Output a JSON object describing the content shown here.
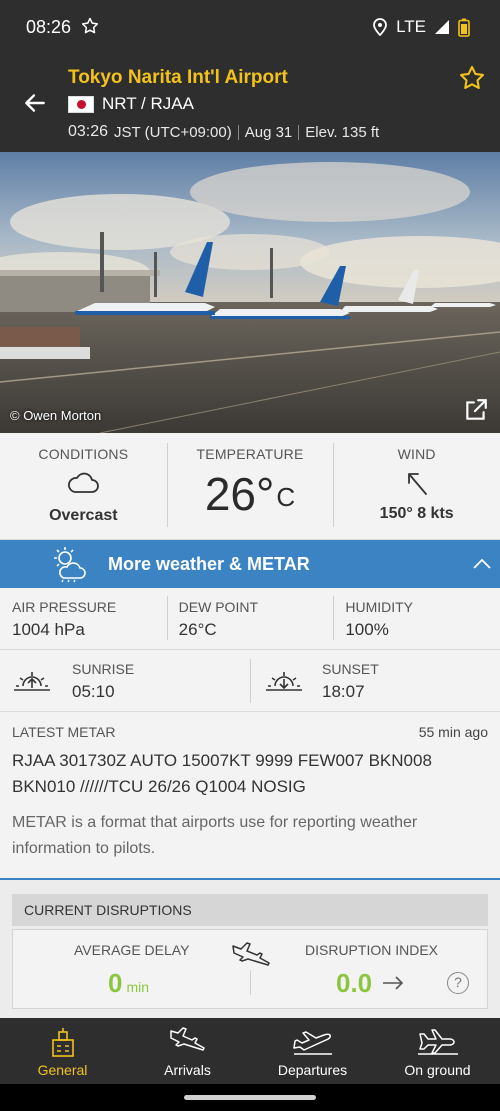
{
  "status_bar": {
    "time": "08:26",
    "network": "LTE"
  },
  "header": {
    "title": "Tokyo Narita Int'l Airport",
    "codes": "NRT / RJAA",
    "local_time": "03:26",
    "timezone": "JST (UTC+09:00)",
    "date": "Aug 31",
    "elevation": "Elev. 135 ft",
    "flag": "japan-flag"
  },
  "hero": {
    "credit": "© Owen Morton"
  },
  "conditions": {
    "conditions_label": "CONDITIONS",
    "conditions_value": "Overcast",
    "temperature_label": "TEMPERATURE",
    "temperature_value": "26°",
    "temperature_unit": "C",
    "wind_label": "WIND",
    "wind_value": "150° 8 kts"
  },
  "weather_bar": {
    "label": "More weather & METAR"
  },
  "stats": {
    "pressure_label": "AIR PRESSURE",
    "pressure_value": "1004 hPa",
    "dew_label": "DEW POINT",
    "dew_value": "26°C",
    "humidity_label": "HUMIDITY",
    "humidity_value": "100%"
  },
  "sun": {
    "sunrise_label": "SUNRISE",
    "sunrise_value": "05:10",
    "sunset_label": "SUNSET",
    "sunset_value": "18:07"
  },
  "metar": {
    "label": "LATEST METAR",
    "age": "55 min ago",
    "raw": "RJAA 301730Z AUTO 15007KT 9999 FEW007 BKN008 BKN010 //////TCU 26/26 Q1004 NOSIG",
    "note": "METAR is a format that airports use for reporting weather information to pilots."
  },
  "disruptions": {
    "header": "CURRENT DISRUPTIONS",
    "avg_delay_label": "AVERAGE DELAY",
    "avg_delay_value": "0",
    "avg_delay_unit": "min",
    "index_label": "DISRUPTION INDEX",
    "index_value": "0.0",
    "help_glyph": "?"
  },
  "tabs": [
    {
      "label": "General",
      "icon": "airport-building-icon",
      "active": true
    },
    {
      "label": "Arrivals",
      "icon": "arrival-plane-icon",
      "active": false
    },
    {
      "label": "Departures",
      "icon": "departure-plane-icon",
      "active": false
    },
    {
      "label": "On ground",
      "icon": "plane-on-ground-icon",
      "active": false
    }
  ],
  "colors": {
    "accent": "#f2c21b",
    "bar_blue": "#3b83c3",
    "good_green": "#8cc63f",
    "dark": "#2e2e2e"
  }
}
